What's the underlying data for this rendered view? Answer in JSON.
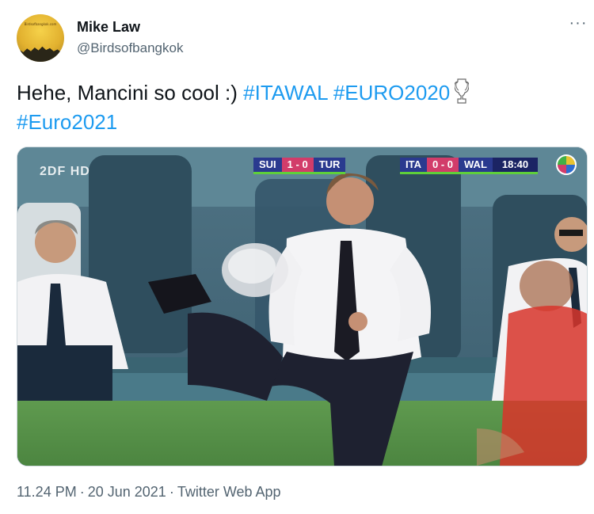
{
  "user": {
    "display_name": "Mike Law",
    "handle": "@Birdsofbangkok",
    "avatar_text": "Birdsofbangkok.com"
  },
  "tweet": {
    "text_plain": "Hehe, Mancini so cool :) ",
    "hashtags": [
      "#ITAWAL",
      "#EURO2020",
      "#Euro2021"
    ],
    "emoji": "trophy-icon"
  },
  "more_label": "···",
  "media": {
    "broadcaster": "2DF",
    "broadcaster_hd": "HD",
    "scoreboard_1": {
      "home": "SUI",
      "score": "1 - 0",
      "away": "TUR"
    },
    "scoreboard_2": {
      "home": "ITA",
      "score": "0 - 0",
      "away": "WAL",
      "clock": "18:40"
    }
  },
  "footer": {
    "time": "11.24 PM",
    "date": "20 Jun 2021",
    "source": "Twitter Web App",
    "separator": "·"
  },
  "colors": {
    "link": "#1d9bf0",
    "text": "#0f1419",
    "muted": "#536471"
  }
}
